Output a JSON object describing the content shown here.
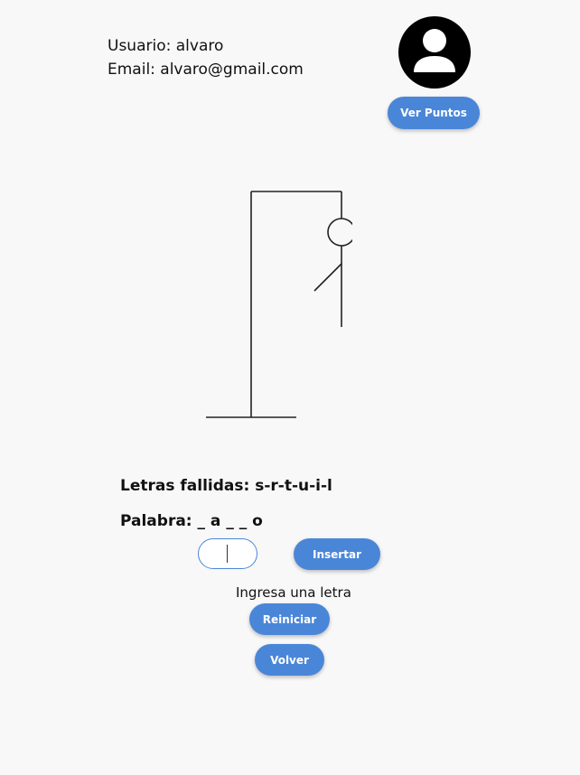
{
  "user": {
    "username_line": "Usuario: alvaro",
    "email_line": "Email: alvaro@gmail.com"
  },
  "avatar": {
    "icon": "user-avatar-icon"
  },
  "actions": {
    "ver_puntos_label": "Ver Puntos",
    "insertar_label": "Insertar",
    "reiniciar_label": "Reiniciar",
    "volver_label": "Volver"
  },
  "game": {
    "failed_letters_line": "Letras fallidas: s-r-t-u-i-l",
    "word_line": "Palabra: _ a _ _ o",
    "letter_input_value": "",
    "letter_hint": "Ingresa una letra",
    "wrong_guesses": 6,
    "hangman_parts_drawn": [
      "head",
      "body",
      "left-arm"
    ]
  },
  "colors": {
    "accent": "#4a86d8",
    "background": "#f8f8f8",
    "text": "#111111"
  }
}
